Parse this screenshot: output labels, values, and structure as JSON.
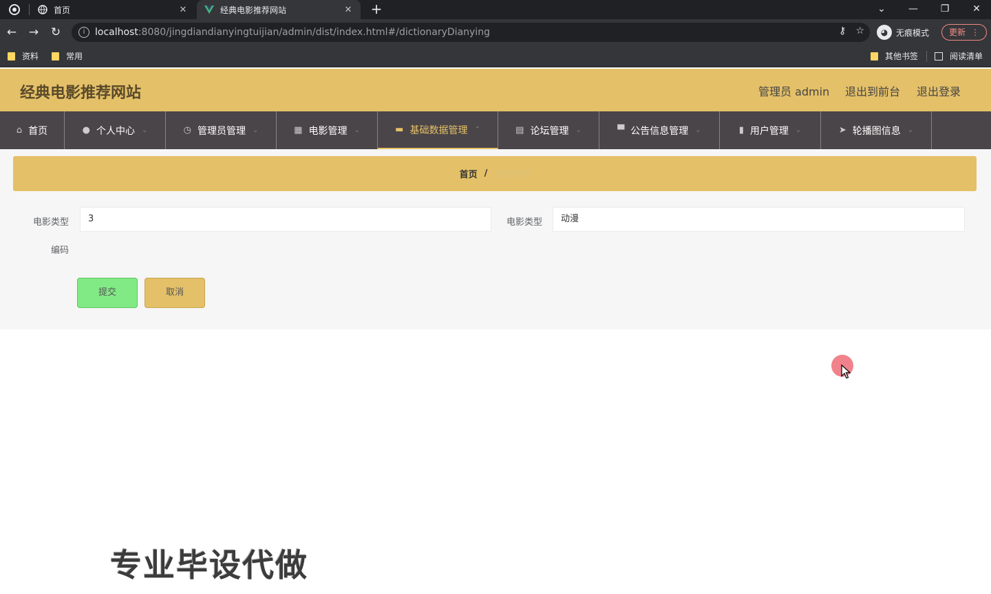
{
  "browser": {
    "tabs": [
      {
        "title": "首页",
        "icon": "globe-icon"
      },
      {
        "title": "经典电影推荐网站",
        "icon": "vue-icon"
      }
    ],
    "url_host": "localhost",
    "url_rest": ":8080/jingdiandianyingtuijian/admin/dist/index.html#/dictionaryDianying",
    "profile_label": "无痕模式",
    "update_label": "更新",
    "bookmarks": [
      "资料",
      "常用"
    ],
    "other_bookmarks": "其他书签",
    "reading_list": "阅读清单"
  },
  "header": {
    "title": "经典电影推荐网站",
    "admin_label": "管理员 admin",
    "exit_front": "退出到前台",
    "logout": "退出登录"
  },
  "menu": [
    {
      "label": "首页",
      "icon": "home-icon",
      "has_caret": false,
      "active": false
    },
    {
      "label": "个人中心",
      "icon": "user-icon",
      "has_caret": true,
      "active": false
    },
    {
      "label": "管理员管理",
      "icon": "clock-icon",
      "has_caret": true,
      "active": false
    },
    {
      "label": "电影管理",
      "icon": "calendar-icon",
      "has_caret": true,
      "active": false
    },
    {
      "label": "基础数据管理",
      "icon": "briefcase-icon",
      "has_caret": true,
      "active": true
    },
    {
      "label": "论坛管理",
      "icon": "document-icon",
      "has_caret": true,
      "active": false
    },
    {
      "label": "公告信息管理",
      "icon": "monitor-icon",
      "has_caret": true,
      "active": false
    },
    {
      "label": "用户管理",
      "icon": "bar-chart-icon",
      "has_caret": true,
      "active": false
    },
    {
      "label": "轮播图信息",
      "icon": "send-icon",
      "has_caret": true,
      "active": false
    }
  ],
  "breadcrumb": {
    "home": "首页",
    "separator": "/",
    "current": "电影类型"
  },
  "form": {
    "field1_label": "电影类型",
    "field1_value": "3",
    "field2_label": "电影类型",
    "field2_value": "动漫",
    "field3_label": "编码",
    "submit_label": "提交",
    "cancel_label": "取消"
  },
  "watermark": "专业毕设代做",
  "colors": {
    "theme_gold": "#e4c068",
    "menu_bg": "#4a4548",
    "submit_green": "#82ea85"
  }
}
